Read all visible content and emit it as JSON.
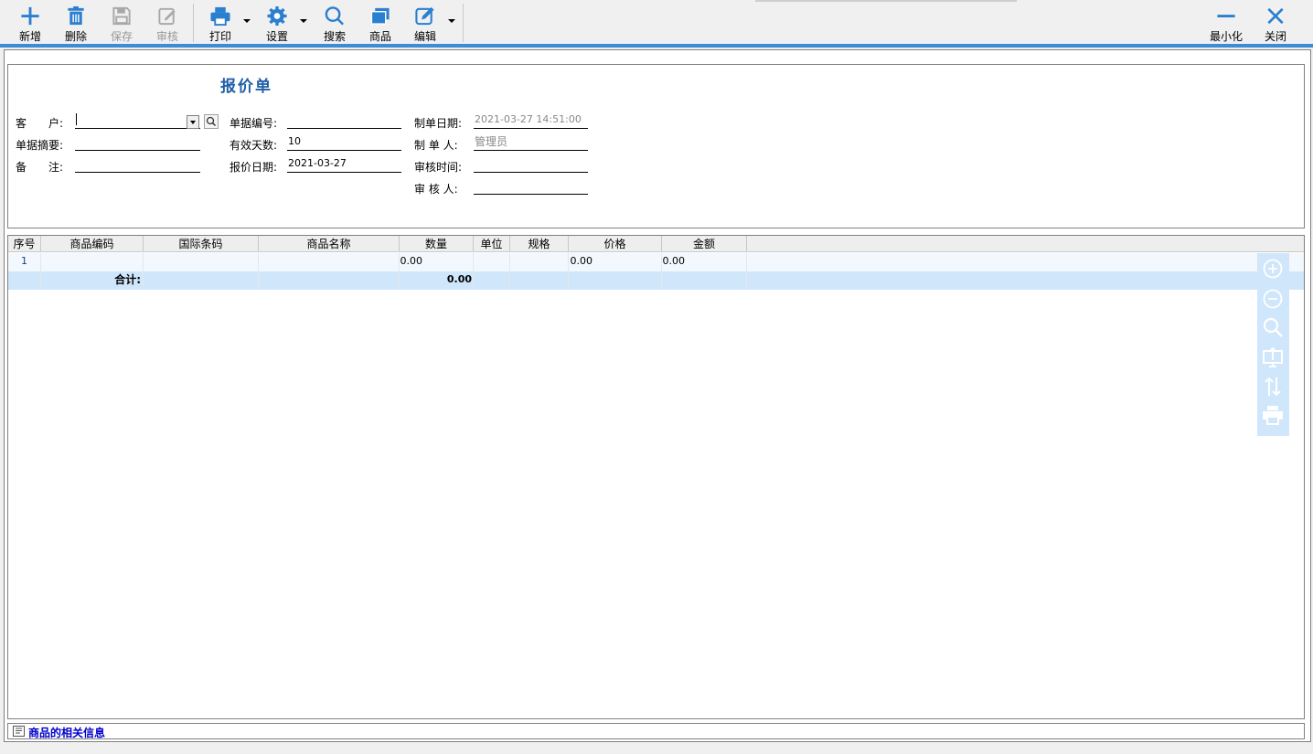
{
  "toolbar": {
    "add": "新增",
    "delete": "删除",
    "save": "保存",
    "audit": "审核",
    "print": "打印",
    "settings": "设置",
    "search": "搜索",
    "goods": "商品",
    "edit": "编辑",
    "minimize": "最小化",
    "close": "关闭"
  },
  "form": {
    "title": "报价单",
    "customer_label": "客　　户:",
    "customer_value": "",
    "summary_label": "单据摘要:",
    "summary_value": "",
    "remark_label": "备　　注:",
    "remark_value": "",
    "bill_no_label": "单据编号:",
    "bill_no_value": "",
    "valid_days_label": "有效天数:",
    "valid_days_value": "10",
    "quote_date_label": "报价日期:",
    "quote_date_value": "2021-03-27",
    "create_date_label": "制单日期:",
    "create_date_value": "2021-03-27 14:51:00",
    "creator_label": "制 单 人:",
    "creator_value": "管理员",
    "audit_time_label": "审核时间:",
    "audit_time_value": "",
    "auditor_label": "审 核 人:",
    "auditor_value": ""
  },
  "grid": {
    "columns": [
      "序号",
      "商品编码",
      "国际条码",
      "商品名称",
      "数量",
      "单位",
      "规格",
      "价格",
      "金额"
    ],
    "rows": [
      {
        "index": "1",
        "code": "",
        "barcode": "",
        "name": "",
        "qty": "0.00",
        "unit": "",
        "spec": "",
        "price": "0.00",
        "amount": "0.00"
      }
    ],
    "total": {
      "label": "合计:",
      "qty": "0.00"
    }
  },
  "side_tools": [
    "add-row-icon",
    "remove-row-icon",
    "zoom-icon",
    "export-icon",
    "sort-icon",
    "print-icon"
  ],
  "footer": {
    "text": "商品的相关信息"
  },
  "colors": {
    "accent": "#3b8ed3",
    "title": "#1f5fa8",
    "total_row": "#cfe6fb",
    "link": "#0000cc"
  }
}
